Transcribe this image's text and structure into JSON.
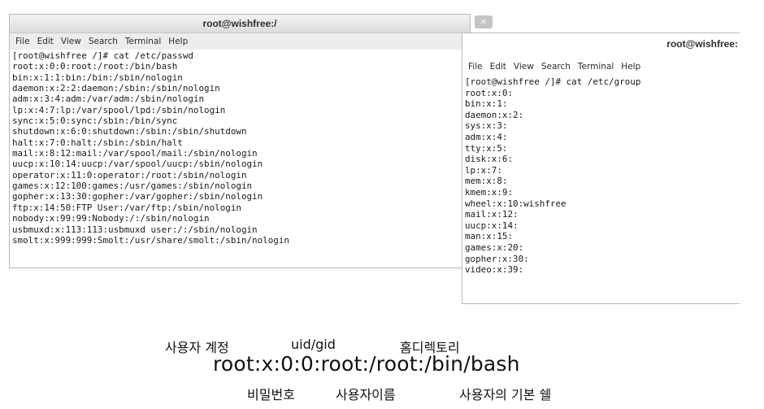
{
  "window_left": {
    "title": "root@wishfree:/",
    "close_glyph": "×",
    "menu": [
      "File",
      "Edit",
      "View",
      "Search",
      "Terminal",
      "Help"
    ],
    "lines": [
      "[root@wishfree /]# cat /etc/passwd",
      "root:x:0:0:root:/root:/bin/bash",
      "bin:x:1:1:bin:/bin:/sbin/nologin",
      "daemon:x:2:2:daemon:/sbin:/sbin/nologin",
      "adm:x:3:4:adm:/var/adm:/sbin/nologin",
      "lp:x:4:7:lp:/var/spool/lpd:/sbin/nologin",
      "sync:x:5:0:sync:/sbin:/bin/sync",
      "shutdown:x:6:0:shutdown:/sbin:/sbin/shutdown",
      "halt:x:7:0:halt:/sbin:/sbin/halt",
      "mail:x:8:12:mail:/var/spool/mail:/sbin/nologin",
      "uucp:x:10:14:uucp:/var/spool/uucp:/sbin/nologin",
      "operator:x:11:0:operator:/root:/sbin/nologin",
      "games:x:12:100:games:/usr/games:/sbin/nologin",
      "gopher:x:13:30:gopher:/var/gopher:/sbin/nologin",
      "ftp:x:14:50:FTP User:/var/ftp:/sbin/nologin",
      "nobody:x:99:99:Nobody:/:/sbin/nologin",
      "usbmuxd:x:113:113:usbmuxd user:/:/sbin/nologin",
      "smolt:x:999:999:Smolt:/usr/share/smolt:/sbin/nologin"
    ]
  },
  "window_right": {
    "title": "root@wishfree:",
    "menu": [
      "File",
      "Edit",
      "View",
      "Search",
      "Terminal",
      "Help"
    ],
    "lines": [
      "[root@wishfree /]# cat /etc/group",
      "root:x:0:",
      "bin:x:1:",
      "daemon:x:2:",
      "sys:x:3:",
      "adm:x:4:",
      "tty:x:5:",
      "disk:x:6:",
      "lp:x:7:",
      "mem:x:8:",
      "kmem:x:9:",
      "wheel:x:10:wishfree",
      "mail:x:12:",
      "uucp:x:14:",
      "man:x:15:",
      "games:x:20:",
      "gopher:x:30:",
      "video:x:39:"
    ]
  },
  "annotation": {
    "account": "사용자 계정",
    "uid_gid": "uid/gid",
    "home": "홈디렉토리",
    "example": "root:x:0:0:root:/root:/bin/bash",
    "password": "비밀번호",
    "user_name": "사용자이름",
    "shell": "사용자의 기본 쉘"
  }
}
